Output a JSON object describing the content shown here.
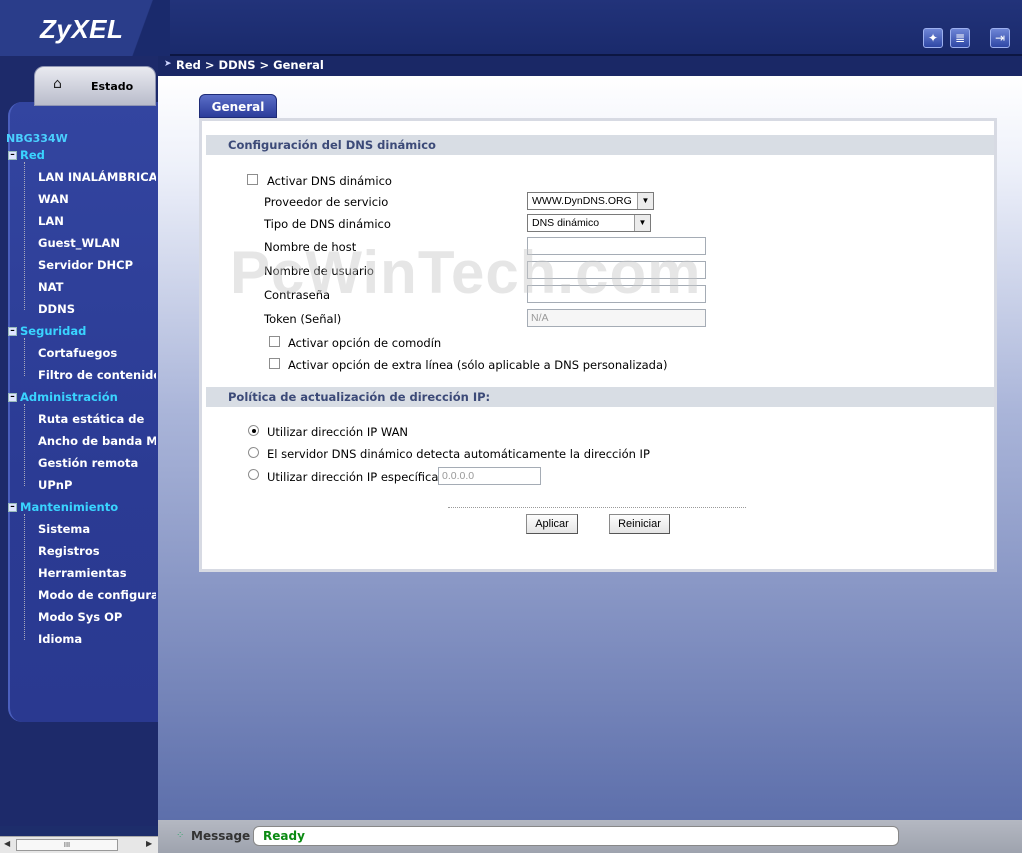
{
  "header": {
    "logo": "ZyXEL",
    "icons": [
      "wizard-icon",
      "notepad-icon",
      "logout-icon"
    ]
  },
  "sidebar": {
    "status_tab": "Estado",
    "model": "NBG334W",
    "sections": [
      {
        "label": "Red",
        "items": [
          "LAN INALÁMBRICA",
          "WAN",
          "LAN",
          "Guest_WLAN",
          "Servidor DHCP",
          "NAT",
          "DDNS"
        ]
      },
      {
        "label": "Seguridad",
        "items": [
          "Cortafuegos",
          "Filtro de contenido"
        ]
      },
      {
        "label": "Administración",
        "items": [
          "Ruta estática de",
          "Ancho de banda M",
          "Gestión remota",
          "UPnP"
        ]
      },
      {
        "label": "Mantenimiento",
        "items": [
          "Sistema",
          "Registros",
          "Herramientas",
          "Modo de configura",
          "Modo Sys OP",
          "Idioma"
        ]
      }
    ],
    "scroll_label": "III"
  },
  "breadcrumb": "Red > DDNS > General",
  "tab": "General",
  "ddns": {
    "section_title": "Configuración del DNS dinámico",
    "enable_label": "Activar DNS dinámico",
    "provider_label": "Proveedor de servicio",
    "provider_value": "WWW.DynDNS.ORG",
    "type_label": "Tipo de DNS dinámico",
    "type_value": "DNS dinámico",
    "host_label": "Nombre de host",
    "user_label": "Nombre de usuario",
    "password_label": "Contraseña",
    "token_label": "Token (Señal)",
    "token_value": "N/A",
    "wildcard_label": "Activar opción de comodín",
    "extra_line_label": "Activar opción de extra línea (sólo aplicable a DNS personalizada)"
  },
  "ip_policy": {
    "section_title": "Política de actualización de dirección IP:",
    "option_wan": "Utilizar dirección IP WAN",
    "option_auto": "El servidor DNS dinámico detecta automáticamente la dirección IP",
    "option_specific": "Utilizar dirección IP específica",
    "specific_value": "0.0.0.0"
  },
  "buttons": {
    "apply": "Aplicar",
    "reset": "Reiniciar"
  },
  "watermark": "PcWinTech.com",
  "status": {
    "label": "Message",
    "value": "Ready"
  }
}
